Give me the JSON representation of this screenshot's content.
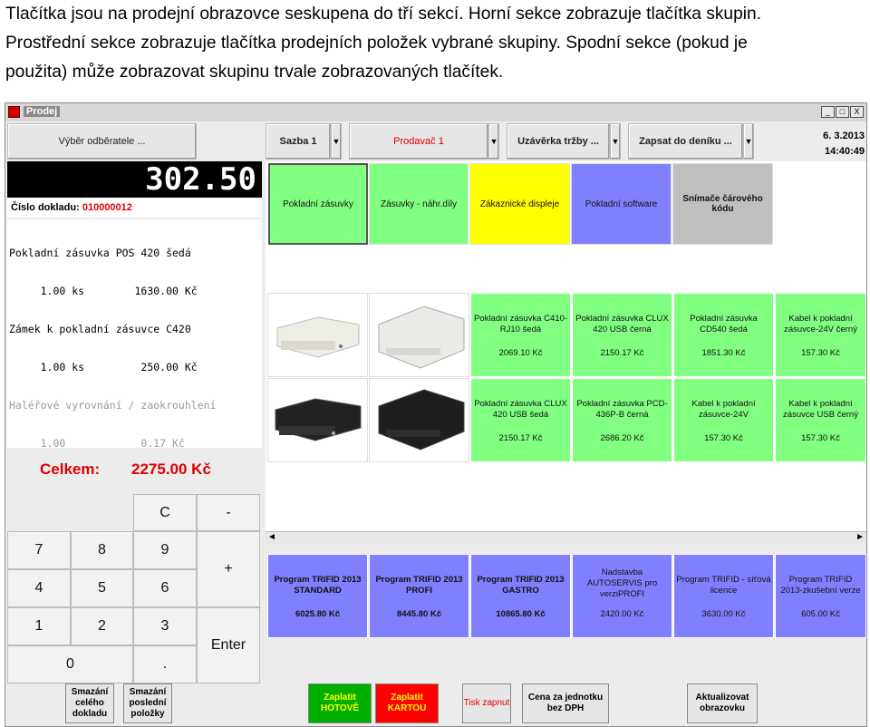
{
  "caption": {
    "line1": "Tlačítka jsou na prodejní obrazovce seskupena do tří sekcí. Horní sekce zobrazuje tlačítka skupin.",
    "line2": "Prostřední sekce zobrazuje tlačítka prodejních položek vybrané skupiny. Spodní sekce (pokud je",
    "line3": "použita) může zobrazovat skupinu trvale zobrazovaných tlačítek."
  },
  "window": {
    "title": "Prodej",
    "min": "_",
    "max": "□",
    "close": "X"
  },
  "toolbar": {
    "customer": "Výběr odběratele ...",
    "rate": "Sazba 1",
    "seller": "Prodavač 1",
    "closing": "Uzávěrka tržby ...",
    "journal": "Zapsat do deníku ...",
    "dropdown_glyph": "▼",
    "date": "6. 3.2013",
    "time": "14:40:49"
  },
  "display": {
    "amount": "302.50",
    "doc_label": "Číslo dokladu:",
    "doc_number": "010000012"
  },
  "receipt": [
    {
      "text": "Pokladní zásuvka POS 420 šedá",
      "gray": false
    },
    {
      "text": "     1.00 ks        1630.00 Kč",
      "gray": false
    },
    {
      "text": "Zámek k pokladní zásuvce C420",
      "gray": false
    },
    {
      "text": "     1.00 ks         250.00 Kč",
      "gray": false
    },
    {
      "text": "Haléřové vyrovnání / zaokrouhlení",
      "gray": true
    },
    {
      "text": "     1.00            0.17 Kč",
      "gray": true
    }
  ],
  "total": {
    "label": "Celkem:",
    "value": "2275.00 Kč"
  },
  "keypad": {
    "c": "C",
    "minus": "-",
    "plus": "+",
    "enter": "Enter",
    "dot": ".",
    "k7": "7",
    "k8": "8",
    "k9": "9",
    "k4": "4",
    "k5": "5",
    "k6": "6",
    "k1": "1",
    "k2": "2",
    "k3": "3",
    "k0": "0"
  },
  "groups": [
    {
      "label": "Pokladní zásuvky",
      "color": "#80ff80"
    },
    {
      "label": "Zásuvky - náhr.díly",
      "color": "#80ff80"
    },
    {
      "label": "Zákaznické displeje",
      "color": "#ffff00"
    },
    {
      "label": "Pokladní software",
      "color": "#8080ff"
    },
    {
      "label": "Snímače čárového kódu",
      "color": "#c0c0c0"
    }
  ],
  "items_row1": [
    {
      "name": "Pokladní zásuvka C410-RJ10 šedá",
      "price": "2069.10 Kč"
    },
    {
      "name": "Pokladní zásuvka CLUX 420 USB černá",
      "price": "2150.17 Kč"
    },
    {
      "name": "Pokladní zásuvka CD540 šedá",
      "price": "1851.30 Kč"
    },
    {
      "name": "Kabel k pokladní zásuvce-24V černý",
      "price": "157.30 Kč"
    }
  ],
  "items_row2": [
    {
      "name": "Pokladní zásuvka CLUX 420 USB šedá",
      "price": "2150.17 Kč"
    },
    {
      "name": "Pokladní zásuvka PCD-436P-B černá",
      "price": "2686.20 Kč"
    },
    {
      "name": "Kabel k pokladní zásuvce-24V",
      "price": "157.30 Kč"
    },
    {
      "name": "Kabel k pokladní zásuvce USB černý",
      "price": "157.30 Kč"
    }
  ],
  "software": [
    {
      "name": "Program TRIFID 2013 STANDARD",
      "price": "6025.80 Kč",
      "bold": true
    },
    {
      "name": "Program TRIFID 2013 PROFI",
      "price": "8445.80 Kč",
      "bold": true
    },
    {
      "name": "Program TRIFID 2013 GASTRO",
      "price": "10865.80 Kč",
      "bold": true
    },
    {
      "name": "Nadstavba AUTOSERVIS pro verziPROFI",
      "price": "2420.00 Kč",
      "bold": false
    },
    {
      "name": "Program TRIFID - síťová licence",
      "price": "3630.00 Kč",
      "bold": false
    },
    {
      "name": "Program TRIFID 2013-zkušební verze",
      "price": "605.00 Kč",
      "bold": false
    }
  ],
  "scroll": {
    "left": "◄",
    "right": "►"
  },
  "bottom": {
    "delete_doc": "Smazání celého dokladu",
    "delete_last": "Smazání poslední položky",
    "pay_cash": "Zaplatit HOTOVĚ",
    "pay_card": "Zaplatit KARTOU",
    "print": "Tisk zapnut",
    "net_price": "Cena za jednotku bez DPH",
    "refresh": "Aktualizovat obrazovku"
  }
}
